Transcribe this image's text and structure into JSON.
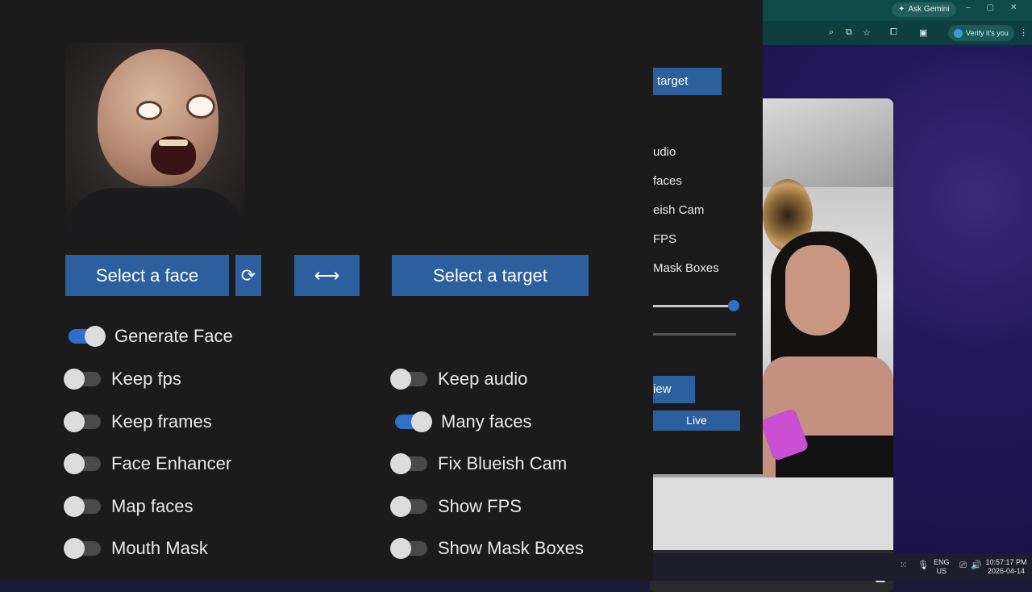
{
  "browser": {
    "ask_gemini_label": "Ask Gemini",
    "verify_label": "Verify it's you",
    "window_controls": [
      "–",
      "▢",
      "✕"
    ],
    "toolbar_icons": [
      "zoom-icon",
      "install-icon",
      "star-icon",
      "extensions-icon",
      "sidebar-icon"
    ]
  },
  "taskbar": {
    "language": "ENG",
    "region": "US",
    "time": "10:57:17 PM",
    "date": "2026-04-14"
  },
  "second_window": {
    "select_target_label": "target",
    "toggles": [
      "udio",
      "faces",
      "eish Cam",
      "FPS",
      "Mask Boxes"
    ],
    "preview_label": "iew",
    "live_label": "Live",
    "slider_value": 1.0
  },
  "main_app": {
    "buttons": {
      "select_face": "Select a face",
      "refresh": "⟳",
      "swap": "⟷",
      "select_target": "Select a target"
    },
    "toggles_left": [
      {
        "label": "Generate Face",
        "on": true
      },
      {
        "label": "Keep fps",
        "on": false
      },
      {
        "label": "Keep frames",
        "on": false
      },
      {
        "label": "Face Enhancer",
        "on": false
      },
      {
        "label": "Map faces",
        "on": false
      },
      {
        "label": "Mouth Mask",
        "on": false
      }
    ],
    "toggles_right": [
      {
        "label": "Keep audio",
        "on": false
      },
      {
        "label": "Many faces",
        "on": true
      },
      {
        "label": "Fix Blueish Cam",
        "on": false
      },
      {
        "label": "Show FPS",
        "on": false
      },
      {
        "label": "Show Mask Boxes",
        "on": false
      }
    ]
  },
  "colors": {
    "accent": "#2b5f9e",
    "switch_on": "#2f71c8",
    "app_bg": "#1b1b1b"
  }
}
